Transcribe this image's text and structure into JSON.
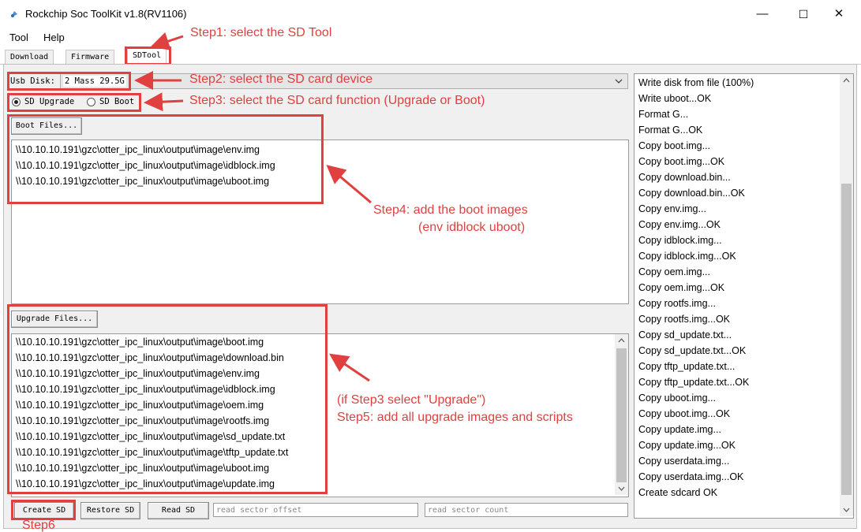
{
  "window": {
    "title": "Rockchip Soc ToolKit v1.8(RV1106)",
    "minimize_glyph": "—",
    "maximize_glyph": "☐",
    "close_glyph": "✕"
  },
  "menu": {
    "items": [
      "Tool",
      "Help"
    ]
  },
  "tabs": [
    {
      "label": "Download",
      "active": false
    },
    {
      "label": "Firmware",
      "active": false
    },
    {
      "label": "SDTool",
      "active": true
    }
  ],
  "usb_disk": {
    "label": "Usb Disk:",
    "value": "2 Mass 29.5G"
  },
  "function_radios": [
    {
      "label": "SD Upgrade",
      "selected": true
    },
    {
      "label": "SD Boot",
      "selected": false
    }
  ],
  "boot_files": {
    "button_label": "Boot Files...",
    "items": [
      "\\\\10.10.10.191\\gzc\\otter_ipc_linux\\output\\image\\env.img",
      "\\\\10.10.10.191\\gzc\\otter_ipc_linux\\output\\image\\idblock.img",
      "\\\\10.10.10.191\\gzc\\otter_ipc_linux\\output\\image\\uboot.img"
    ]
  },
  "upgrade_files": {
    "button_label": "Upgrade Files...",
    "items": [
      "\\\\10.10.10.191\\gzc\\otter_ipc_linux\\output\\image\\boot.img",
      "\\\\10.10.10.191\\gzc\\otter_ipc_linux\\output\\image\\download.bin",
      "\\\\10.10.10.191\\gzc\\otter_ipc_linux\\output\\image\\env.img",
      "\\\\10.10.10.191\\gzc\\otter_ipc_linux\\output\\image\\idblock.img",
      "\\\\10.10.10.191\\gzc\\otter_ipc_linux\\output\\image\\oem.img",
      "\\\\10.10.10.191\\gzc\\otter_ipc_linux\\output\\image\\rootfs.img",
      "\\\\10.10.10.191\\gzc\\otter_ipc_linux\\output\\image\\sd_update.txt",
      "\\\\10.10.10.191\\gzc\\otter_ipc_linux\\output\\image\\tftp_update.txt",
      "\\\\10.10.10.191\\gzc\\otter_ipc_linux\\output\\image\\uboot.img",
      "\\\\10.10.10.191\\gzc\\otter_ipc_linux\\output\\image\\update.img"
    ]
  },
  "bottom_bar": {
    "create_label": "Create SD",
    "restore_label": "Restore SD",
    "read_label": "Read SD",
    "offset_placeholder": "read sector offset",
    "count_placeholder": "read sector count"
  },
  "log": [
    "Write disk from file (100%)",
    "Write uboot...OK",
    "Format G...",
    "Format G...OK",
    "Copy boot.img...",
    "Copy boot.img...OK",
    "Copy download.bin...",
    "Copy download.bin...OK",
    "Copy env.img...",
    "Copy env.img...OK",
    "Copy idblock.img...",
    "Copy idblock.img...OK",
    "Copy oem.img...",
    "Copy oem.img...OK",
    "Copy rootfs.img...",
    "Copy rootfs.img...OK",
    "Copy sd_update.txt...",
    "Copy sd_update.txt...OK",
    "Copy tftp_update.txt...",
    "Copy tftp_update.txt...OK",
    "Copy uboot.img...",
    "Copy uboot.img...OK",
    "Copy update.img...",
    "Copy update.img...OK",
    "Copy userdata.img...",
    "Copy userdata.img...OK",
    "Create sdcard OK"
  ],
  "annotations": {
    "step1": "Step1:  select the SD Tool",
    "step2": "Step2:  select the SD card device",
    "step3": "Step3:  select the SD card function (Upgrade or Boot)",
    "step4_line1": "Step4:  add the boot images",
    "step4_line2": "(env idblock uboot)",
    "step5_line1": "(if Step3 select \"Upgrade\")",
    "step5_line2": "Step5:  add all upgrade images and scripts",
    "step6": "Step6"
  },
  "colors": {
    "annotation_red": "#e0403f",
    "window_bg": "#f0f0f0"
  }
}
